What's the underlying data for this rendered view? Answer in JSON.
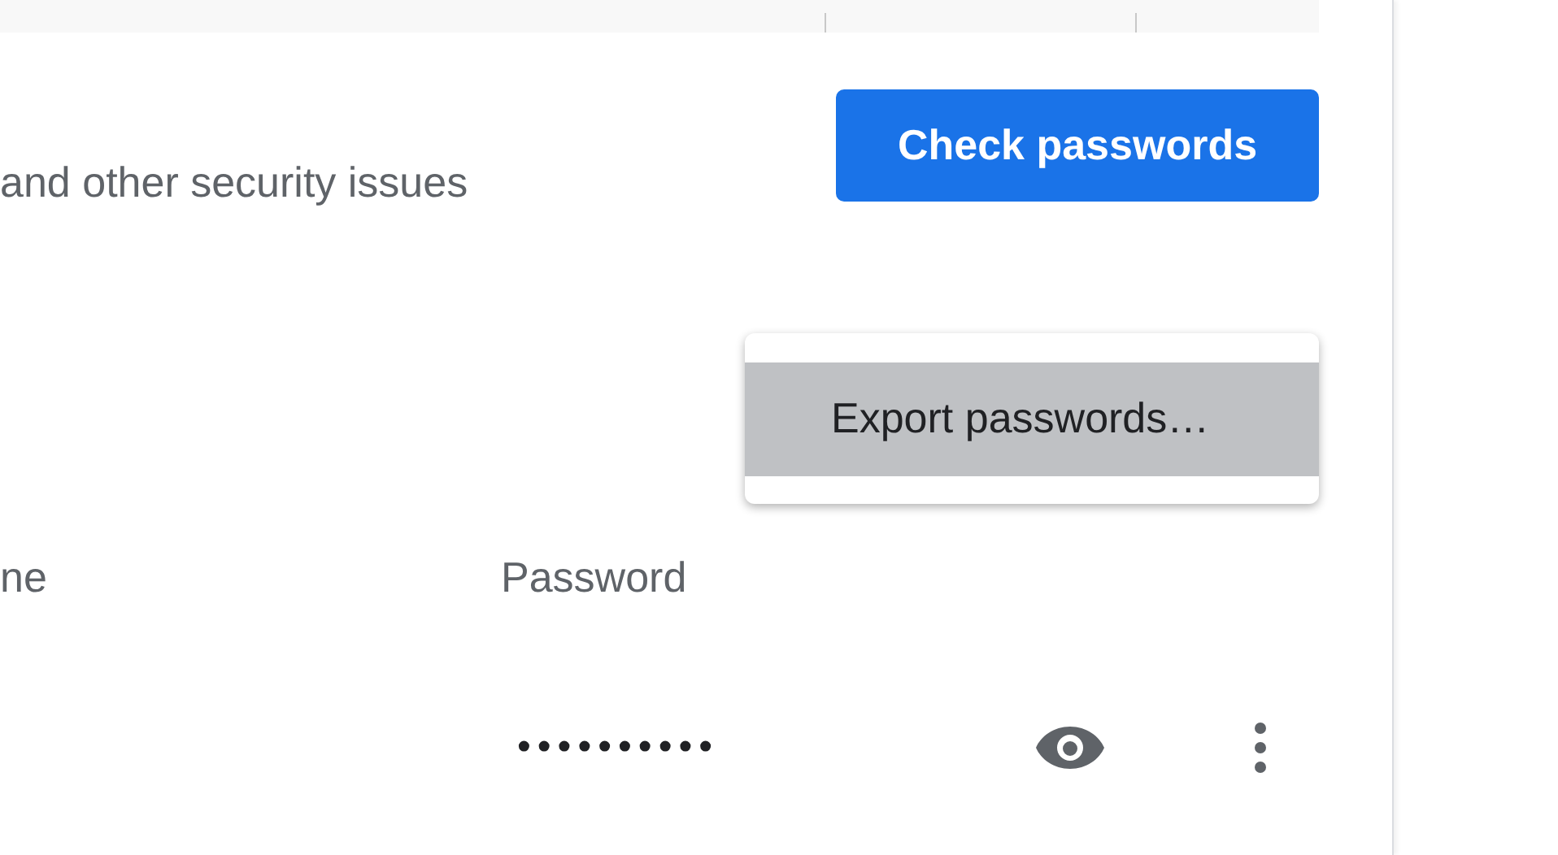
{
  "check_section": {
    "description": "and other security issues",
    "button": "Check passwords"
  },
  "menu": {
    "items": [
      {
        "label": "Export passwords…",
        "selected": true
      }
    ]
  },
  "table": {
    "columns": [
      "ne",
      "Password"
    ],
    "rows": [
      {
        "password": "••••••••••"
      }
    ]
  }
}
